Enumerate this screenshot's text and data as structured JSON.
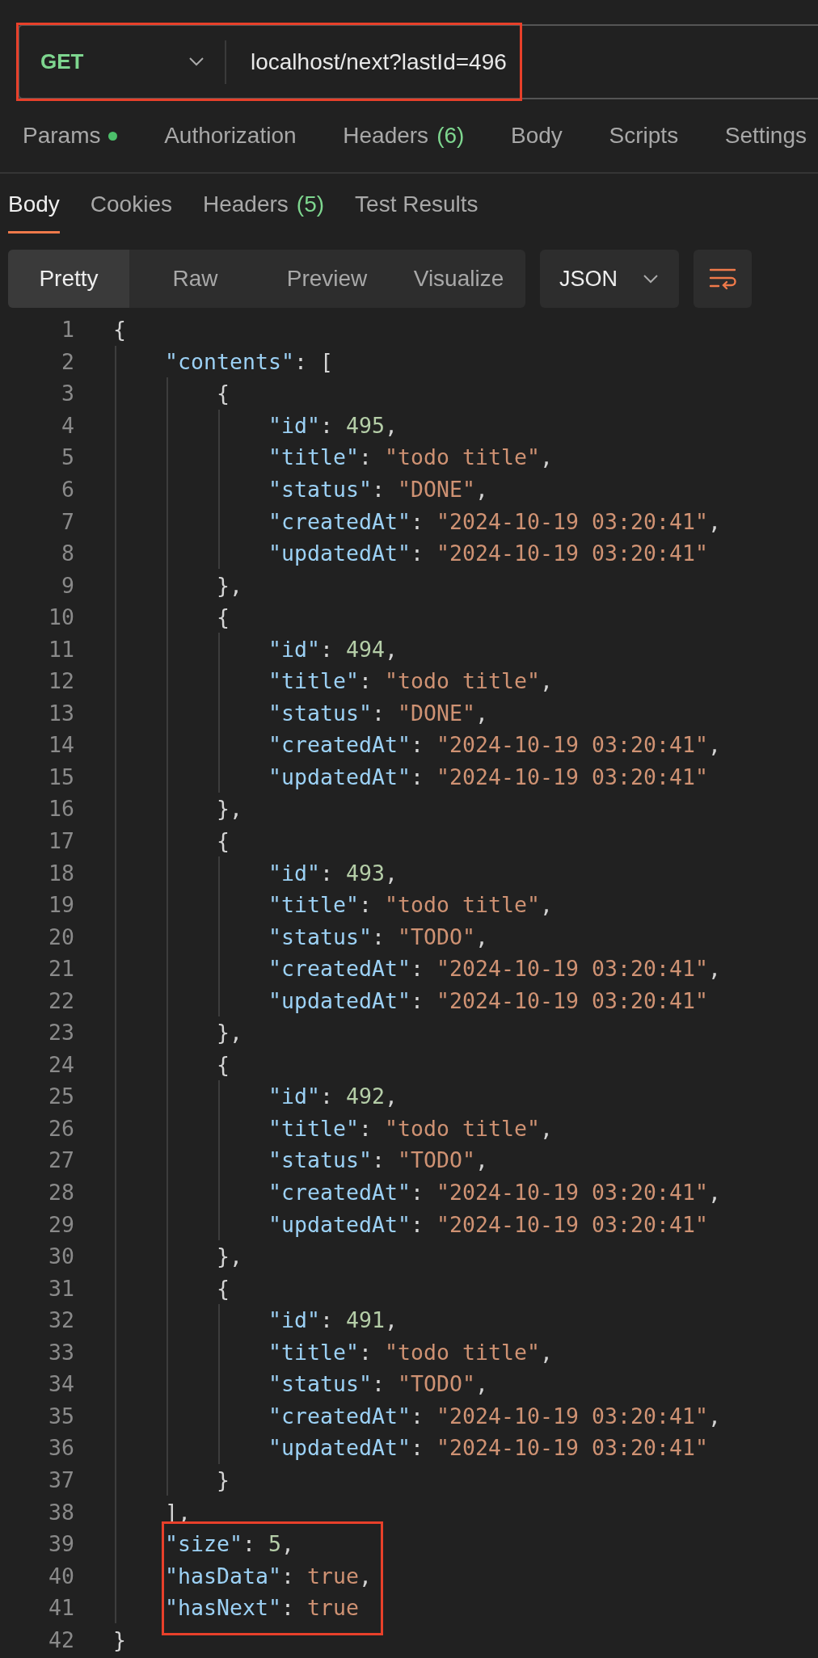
{
  "request": {
    "method": "GET",
    "url": "localhost/next?lastId=496",
    "highlighted": true
  },
  "request_tabs": [
    {
      "label": "Params",
      "indicator": true,
      "selected": false
    },
    {
      "label": "Authorization",
      "indicator": false,
      "selected": false
    },
    {
      "label": "Headers",
      "count": "(6)",
      "indicator": false,
      "selected": false
    },
    {
      "label": "Body",
      "indicator": false,
      "selected": false
    },
    {
      "label": "Scripts",
      "indicator": false,
      "selected": false
    },
    {
      "label": "Settings",
      "indicator": false,
      "selected": false
    }
  ],
  "response_tabs": [
    {
      "label": "Body",
      "selected": true
    },
    {
      "label": "Cookies",
      "selected": false
    },
    {
      "label": "Headers",
      "count": "(5)",
      "selected": false
    },
    {
      "label": "Test Results",
      "selected": false
    }
  ],
  "view_modes": [
    {
      "label": "Pretty",
      "selected": true
    },
    {
      "label": "Raw",
      "selected": false
    },
    {
      "label": "Preview",
      "selected": false
    },
    {
      "label": "Visualize",
      "selected": false
    }
  ],
  "format": "JSON",
  "code_lines": [
    {
      "number": "1",
      "tokens": [
        {
          "kind": "punct",
          "text": "{"
        }
      ],
      "children": [
        {
          "number": "2",
          "tokens": [
            {
              "kind": "key",
              "text": "\"contents\""
            },
            {
              "kind": "punct",
              "text": ": ["
            }
          ],
          "children": [
            {
              "number": "3",
              "tokens": [
                {
                  "kind": "punct",
                  "text": "{"
                }
              ],
              "children": [
                {
                  "number": "4",
                  "tokens": [
                    {
                      "kind": "key",
                      "text": "\"id\""
                    },
                    {
                      "kind": "punct",
                      "text": ": "
                    },
                    {
                      "kind": "number",
                      "text": "495"
                    },
                    {
                      "kind": "punct",
                      "text": ","
                    }
                  ]
                },
                {
                  "number": "5",
                  "tokens": [
                    {
                      "kind": "key",
                      "text": "\"title\""
                    },
                    {
                      "kind": "punct",
                      "text": ": "
                    },
                    {
                      "kind": "string",
                      "text": "\"todo title\""
                    },
                    {
                      "kind": "punct",
                      "text": ","
                    }
                  ]
                },
                {
                  "number": "6",
                  "tokens": [
                    {
                      "kind": "key",
                      "text": "\"status\""
                    },
                    {
                      "kind": "punct",
                      "text": ": "
                    },
                    {
                      "kind": "string",
                      "text": "\"DONE\""
                    },
                    {
                      "kind": "punct",
                      "text": ","
                    }
                  ]
                },
                {
                  "number": "7",
                  "tokens": [
                    {
                      "kind": "key",
                      "text": "\"createdAt\""
                    },
                    {
                      "kind": "punct",
                      "text": ": "
                    },
                    {
                      "kind": "string",
                      "text": "\"2024-10-19 03:20:41\""
                    },
                    {
                      "kind": "punct",
                      "text": ","
                    }
                  ]
                },
                {
                  "number": "8",
                  "tokens": [
                    {
                      "kind": "key",
                      "text": "\"updatedAt\""
                    },
                    {
                      "kind": "punct",
                      "text": ": "
                    },
                    {
                      "kind": "string",
                      "text": "\"2024-10-19 03:20:41\""
                    }
                  ]
                }
              ]
            },
            {
              "number": "9",
              "tokens": [
                {
                  "kind": "punct",
                  "text": "},"
                }
              ]
            },
            {
              "number": "10",
              "tokens": [
                {
                  "kind": "punct",
                  "text": "{"
                }
              ],
              "children": [
                {
                  "number": "11",
                  "tokens": [
                    {
                      "kind": "key",
                      "text": "\"id\""
                    },
                    {
                      "kind": "punct",
                      "text": ": "
                    },
                    {
                      "kind": "number",
                      "text": "494"
                    },
                    {
                      "kind": "punct",
                      "text": ","
                    }
                  ]
                },
                {
                  "number": "12",
                  "tokens": [
                    {
                      "kind": "key",
                      "text": "\"title\""
                    },
                    {
                      "kind": "punct",
                      "text": ": "
                    },
                    {
                      "kind": "string",
                      "text": "\"todo title\""
                    },
                    {
                      "kind": "punct",
                      "text": ","
                    }
                  ]
                },
                {
                  "number": "13",
                  "tokens": [
                    {
                      "kind": "key",
                      "text": "\"status\""
                    },
                    {
                      "kind": "punct",
                      "text": ": "
                    },
                    {
                      "kind": "string",
                      "text": "\"DONE\""
                    },
                    {
                      "kind": "punct",
                      "text": ","
                    }
                  ]
                },
                {
                  "number": "14",
                  "tokens": [
                    {
                      "kind": "key",
                      "text": "\"createdAt\""
                    },
                    {
                      "kind": "punct",
                      "text": ": "
                    },
                    {
                      "kind": "string",
                      "text": "\"2024-10-19 03:20:41\""
                    },
                    {
                      "kind": "punct",
                      "text": ","
                    }
                  ]
                },
                {
                  "number": "15",
                  "tokens": [
                    {
                      "kind": "key",
                      "text": "\"updatedAt\""
                    },
                    {
                      "kind": "punct",
                      "text": ": "
                    },
                    {
                      "kind": "string",
                      "text": "\"2024-10-19 03:20:41\""
                    }
                  ]
                }
              ]
            },
            {
              "number": "16",
              "tokens": [
                {
                  "kind": "punct",
                  "text": "},"
                }
              ]
            },
            {
              "number": "17",
              "tokens": [
                {
                  "kind": "punct",
                  "text": "{"
                }
              ],
              "children": [
                {
                  "number": "18",
                  "tokens": [
                    {
                      "kind": "key",
                      "text": "\"id\""
                    },
                    {
                      "kind": "punct",
                      "text": ": "
                    },
                    {
                      "kind": "number",
                      "text": "493"
                    },
                    {
                      "kind": "punct",
                      "text": ","
                    }
                  ]
                },
                {
                  "number": "19",
                  "tokens": [
                    {
                      "kind": "key",
                      "text": "\"title\""
                    },
                    {
                      "kind": "punct",
                      "text": ": "
                    },
                    {
                      "kind": "string",
                      "text": "\"todo title\""
                    },
                    {
                      "kind": "punct",
                      "text": ","
                    }
                  ]
                },
                {
                  "number": "20",
                  "tokens": [
                    {
                      "kind": "key",
                      "text": "\"status\""
                    },
                    {
                      "kind": "punct",
                      "text": ": "
                    },
                    {
                      "kind": "string",
                      "text": "\"TODO\""
                    },
                    {
                      "kind": "punct",
                      "text": ","
                    }
                  ]
                },
                {
                  "number": "21",
                  "tokens": [
                    {
                      "kind": "key",
                      "text": "\"createdAt\""
                    },
                    {
                      "kind": "punct",
                      "text": ": "
                    },
                    {
                      "kind": "string",
                      "text": "\"2024-10-19 03:20:41\""
                    },
                    {
                      "kind": "punct",
                      "text": ","
                    }
                  ]
                },
                {
                  "number": "22",
                  "tokens": [
                    {
                      "kind": "key",
                      "text": "\"updatedAt\""
                    },
                    {
                      "kind": "punct",
                      "text": ": "
                    },
                    {
                      "kind": "string",
                      "text": "\"2024-10-19 03:20:41\""
                    }
                  ]
                }
              ]
            },
            {
              "number": "23",
              "tokens": [
                {
                  "kind": "punct",
                  "text": "},"
                }
              ]
            },
            {
              "number": "24",
              "tokens": [
                {
                  "kind": "punct",
                  "text": "{"
                }
              ],
              "children": [
                {
                  "number": "25",
                  "tokens": [
                    {
                      "kind": "key",
                      "text": "\"id\""
                    },
                    {
                      "kind": "punct",
                      "text": ": "
                    },
                    {
                      "kind": "number",
                      "text": "492"
                    },
                    {
                      "kind": "punct",
                      "text": ","
                    }
                  ]
                },
                {
                  "number": "26",
                  "tokens": [
                    {
                      "kind": "key",
                      "text": "\"title\""
                    },
                    {
                      "kind": "punct",
                      "text": ": "
                    },
                    {
                      "kind": "string",
                      "text": "\"todo title\""
                    },
                    {
                      "kind": "punct",
                      "text": ","
                    }
                  ]
                },
                {
                  "number": "27",
                  "tokens": [
                    {
                      "kind": "key",
                      "text": "\"status\""
                    },
                    {
                      "kind": "punct",
                      "text": ": "
                    },
                    {
                      "kind": "string",
                      "text": "\"TODO\""
                    },
                    {
                      "kind": "punct",
                      "text": ","
                    }
                  ]
                },
                {
                  "number": "28",
                  "tokens": [
                    {
                      "kind": "key",
                      "text": "\"createdAt\""
                    },
                    {
                      "kind": "punct",
                      "text": ": "
                    },
                    {
                      "kind": "string",
                      "text": "\"2024-10-19 03:20:41\""
                    },
                    {
                      "kind": "punct",
                      "text": ","
                    }
                  ]
                },
                {
                  "number": "29",
                  "tokens": [
                    {
                      "kind": "key",
                      "text": "\"updatedAt\""
                    },
                    {
                      "kind": "punct",
                      "text": ": "
                    },
                    {
                      "kind": "string",
                      "text": "\"2024-10-19 03:20:41\""
                    }
                  ]
                }
              ]
            },
            {
              "number": "30",
              "tokens": [
                {
                  "kind": "punct",
                  "text": "},"
                }
              ]
            },
            {
              "number": "31",
              "tokens": [
                {
                  "kind": "punct",
                  "text": "{"
                }
              ],
              "children": [
                {
                  "number": "32",
                  "tokens": [
                    {
                      "kind": "key",
                      "text": "\"id\""
                    },
                    {
                      "kind": "punct",
                      "text": ": "
                    },
                    {
                      "kind": "number",
                      "text": "491"
                    },
                    {
                      "kind": "punct",
                      "text": ","
                    }
                  ]
                },
                {
                  "number": "33",
                  "tokens": [
                    {
                      "kind": "key",
                      "text": "\"title\""
                    },
                    {
                      "kind": "punct",
                      "text": ": "
                    },
                    {
                      "kind": "string",
                      "text": "\"todo title\""
                    },
                    {
                      "kind": "punct",
                      "text": ","
                    }
                  ]
                },
                {
                  "number": "34",
                  "tokens": [
                    {
                      "kind": "key",
                      "text": "\"status\""
                    },
                    {
                      "kind": "punct",
                      "text": ": "
                    },
                    {
                      "kind": "string",
                      "text": "\"TODO\""
                    },
                    {
                      "kind": "punct",
                      "text": ","
                    }
                  ]
                },
                {
                  "number": "35",
                  "tokens": [
                    {
                      "kind": "key",
                      "text": "\"createdAt\""
                    },
                    {
                      "kind": "punct",
                      "text": ": "
                    },
                    {
                      "kind": "string",
                      "text": "\"2024-10-19 03:20:41\""
                    },
                    {
                      "kind": "punct",
                      "text": ","
                    }
                  ]
                },
                {
                  "number": "36",
                  "tokens": [
                    {
                      "kind": "key",
                      "text": "\"updatedAt\""
                    },
                    {
                      "kind": "punct",
                      "text": ": "
                    },
                    {
                      "kind": "string",
                      "text": "\"2024-10-19 03:20:41\""
                    }
                  ]
                }
              ]
            },
            {
              "number": "37",
              "tokens": [
                {
                  "kind": "punct",
                  "text": "}"
                }
              ]
            }
          ]
        },
        {
          "number": "38",
          "tokens": [
            {
              "kind": "punct",
              "text": "],"
            }
          ]
        },
        {
          "number": "39",
          "highlighted": true,
          "tokens": [
            {
              "kind": "key",
              "text": "\"size\""
            },
            {
              "kind": "punct",
              "text": ": "
            },
            {
              "kind": "number",
              "text": "5"
            },
            {
              "kind": "punct",
              "text": ","
            }
          ]
        },
        {
          "number": "40",
          "highlighted": true,
          "tokens": [
            {
              "kind": "key",
              "text": "\"hasData\""
            },
            {
              "kind": "punct",
              "text": ": "
            },
            {
              "kind": "boolean",
              "text": "true"
            },
            {
              "kind": "punct",
              "text": ","
            }
          ]
        },
        {
          "number": "41",
          "highlighted": true,
          "tokens": [
            {
              "kind": "key",
              "text": "\"hasNext\""
            },
            {
              "kind": "punct",
              "text": ": "
            },
            {
              "kind": "boolean",
              "text": "true"
            }
          ]
        }
      ]
    },
    {
      "number": "42",
      "tokens": [
        {
          "kind": "punct",
          "text": "}"
        }
      ]
    }
  ]
}
